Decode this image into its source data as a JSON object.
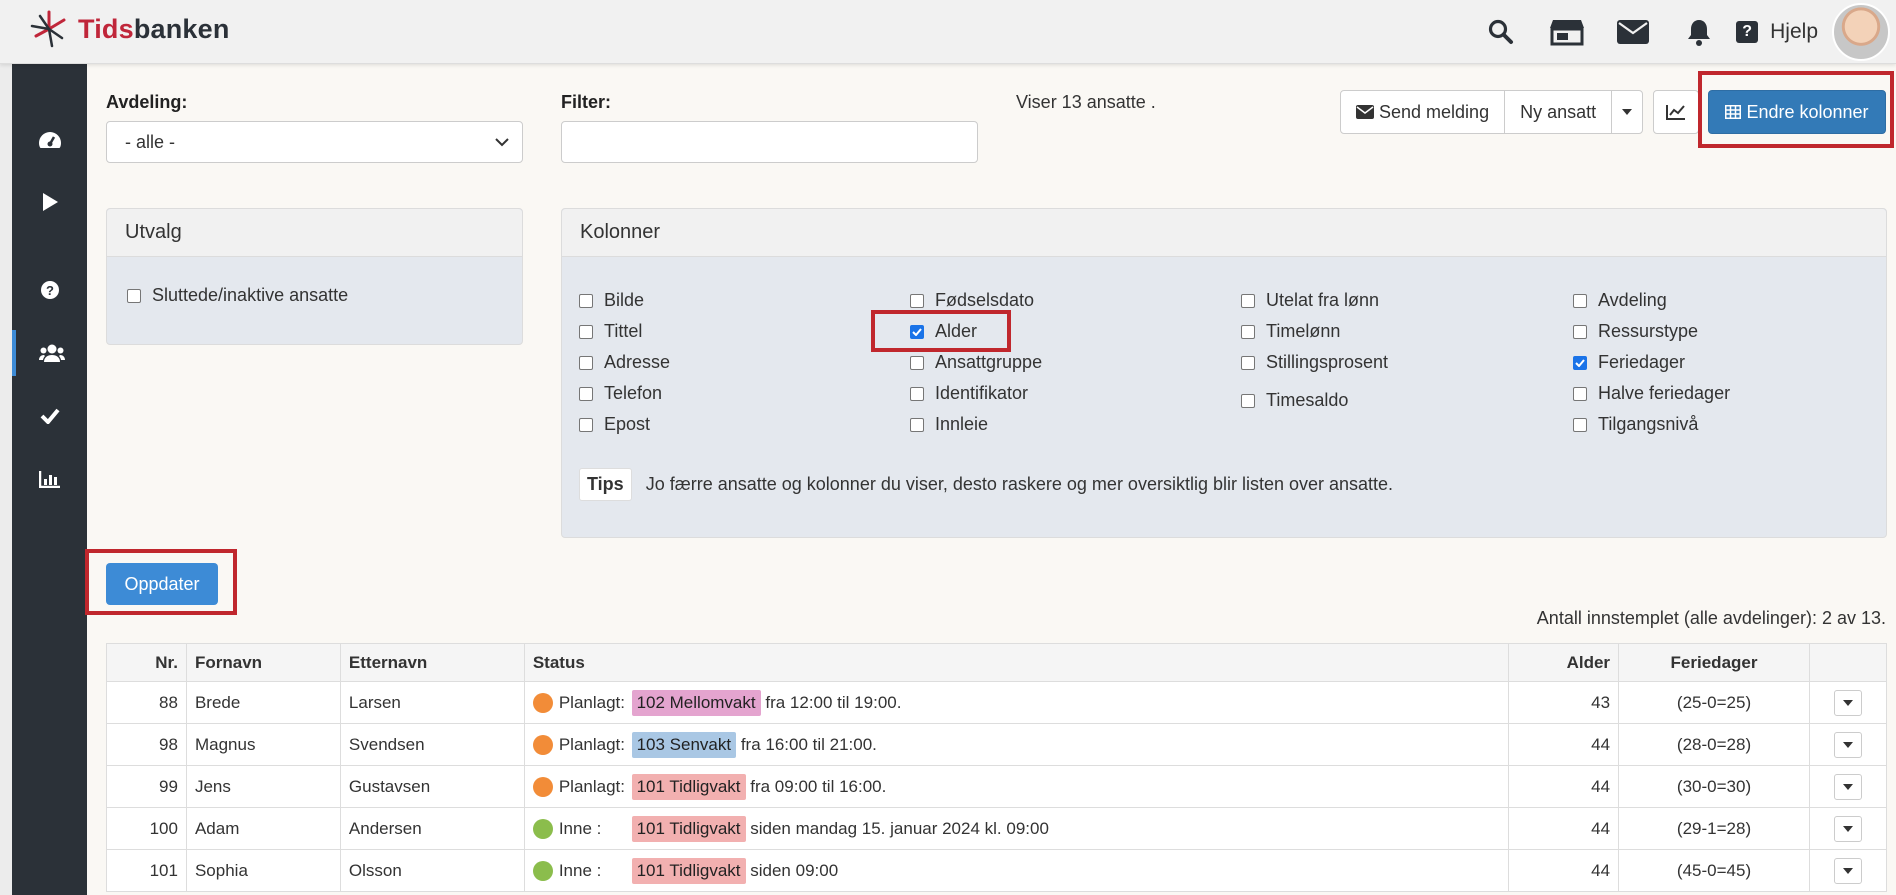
{
  "brand": {
    "part1": "Tids",
    "part2": "banken"
  },
  "header": {
    "help_label": "Hjelp"
  },
  "filters": {
    "department_label": "Avdeling:",
    "department_value": "- alle -",
    "filter_label": "Filter:",
    "filter_value": "",
    "count_text": "Viser 13 ansatte ."
  },
  "actions": {
    "send_message": "Send melding",
    "new_employee": "Ny ansatt",
    "change_columns": "Endre kolonner"
  },
  "selection_panel": {
    "title": "Utvalg",
    "option": {
      "label": "Sluttede/inaktive ansatte",
      "checked": false
    }
  },
  "columns_panel": {
    "title": "Kolonner",
    "columns": [
      [
        {
          "label": "Bilde",
          "checked": false
        },
        {
          "label": "Tittel",
          "checked": false
        },
        {
          "label": "Adresse",
          "checked": false
        },
        {
          "label": "Telefon",
          "checked": false
        },
        {
          "label": "Epost",
          "checked": false
        }
      ],
      [
        {
          "label": "Fødselsdato",
          "checked": false
        },
        {
          "label": "Alder",
          "checked": true
        },
        {
          "label": "Ansattgruppe",
          "checked": false
        },
        {
          "label": "Identifikator",
          "checked": false
        },
        {
          "label": "Innleie",
          "checked": false
        }
      ],
      [
        {
          "label": "Utelat fra lønn",
          "checked": false
        },
        {
          "label": "Timelønn",
          "checked": false
        },
        {
          "label": "Stillingsprosent",
          "checked": false
        },
        {
          "label": "Timesaldo",
          "checked": false
        }
      ],
      [
        {
          "label": "Avdeling",
          "checked": false
        },
        {
          "label": "Ressurstype",
          "checked": false
        },
        {
          "label": "Feriedager",
          "checked": true
        },
        {
          "label": "Halve feriedager",
          "checked": false
        },
        {
          "label": "Tilgangsnivå",
          "checked": false
        }
      ]
    ],
    "tips_badge": "Tips",
    "tips_text": "Jo færre ansatte og kolonner du viser, desto raskere og mer oversiktlig blir listen over ansatte."
  },
  "update_button": "Oppdater",
  "clocked_in_text": "Antall innstemplet (alle avdelinger): 2 av 13.",
  "table": {
    "headers": [
      "Nr.",
      "Fornavn",
      "Etternavn",
      "Status",
      "Alder",
      "Feriedager"
    ],
    "rows": [
      {
        "nr": "88",
        "first": "Brede",
        "last": "Larsen",
        "status_label": "Planlagt:",
        "dot_color": "#f28c38",
        "shift": "102 Mellomvakt",
        "shift_color": "#e4a4cf",
        "rest": "fra 12:00 til 19:00.",
        "age": "43",
        "vacation": "(25-0=25)"
      },
      {
        "nr": "98",
        "first": "Magnus",
        "last": "Svendsen",
        "status_label": "Planlagt:",
        "dot_color": "#f28c38",
        "shift": "103 Senvakt",
        "shift_color": "#a9c7e4",
        "rest": "fra 16:00 til 21:00.",
        "age": "44",
        "vacation": "(28-0=28)"
      },
      {
        "nr": "99",
        "first": "Jens",
        "last": "Gustavsen",
        "status_label": "Planlagt:",
        "dot_color": "#f28c38",
        "shift": "101 Tidligvakt",
        "shift_color": "#f2b0b0",
        "rest": "fra 09:00 til 16:00.",
        "age": "44",
        "vacation": "(30-0=30)"
      },
      {
        "nr": "100",
        "first": "Adam",
        "last": "Andersen",
        "status_label": "Inne :",
        "dot_color": "#8bbd4c",
        "shift": "101 Tidligvakt",
        "shift_color": "#f2b0b0",
        "rest": "siden mandag 15. januar 2024 kl. 09:00",
        "age": "44",
        "vacation": "(29-1=28)"
      },
      {
        "nr": "101",
        "first": "Sophia",
        "last": "Olsson",
        "status_label": "Inne :",
        "dot_color": "#8bbd4c",
        "shift": "101 Tidligvakt",
        "shift_color": "#f2b0b0",
        "rest": "siden 09:00",
        "age": "44",
        "vacation": "(45-0=45)"
      }
    ]
  },
  "icons": {
    "top": [
      "search-icon",
      "store-icon",
      "envelope-icon",
      "bell-icon",
      "question-icon"
    ],
    "sidebar": [
      "dashboard-icon",
      "play-icon",
      "help-icon",
      "users-icon",
      "check-icon",
      "chart-bar-icon"
    ]
  },
  "colors": {
    "primary": "#337ab7",
    "sidebar": "#2b3138",
    "brand_red": "#c0263a",
    "highlight": "#c0272d"
  }
}
